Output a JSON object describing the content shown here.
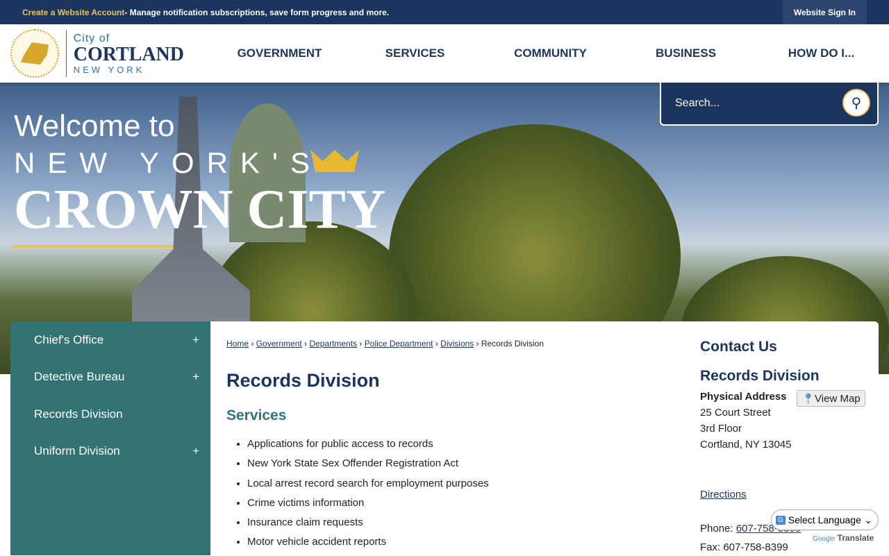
{
  "topbar": {
    "account_link": "Create a Website Account",
    "account_text": " - Manage notification subscriptions, save form progress and more.",
    "sign_in": "Website Sign In"
  },
  "logo": {
    "line1": "City of",
    "line2": "CORTLAND",
    "line3": "NEW YORK"
  },
  "nav": [
    "GOVERNMENT",
    "SERVICES",
    "COMMUNITY",
    "BUSINESS",
    "HOW DO I..."
  ],
  "hero": {
    "line1": "Welcome to",
    "line2": "NEW YORK'S",
    "line3": "CROWN CITY"
  },
  "search": {
    "placeholder": "Search..."
  },
  "sidebar": [
    {
      "label": "Chief's Office",
      "expand": "+"
    },
    {
      "label": "Detective Bureau",
      "expand": "+"
    },
    {
      "label": "Records Division",
      "expand": ""
    },
    {
      "label": "Uniform Division",
      "expand": "+"
    }
  ],
  "breadcrumb": [
    "Home",
    "Government",
    "Departments",
    "Police Department",
    "Divisions"
  ],
  "breadcrumb_current": "Records Division",
  "page_title": "Records Division",
  "section_title": "Services",
  "services": [
    "Applications for public access to records",
    "New York State Sex Offender Registration Act",
    "Local arrest record search for employment purposes",
    "Crime victims information",
    "Insurance claim requests",
    "Motor vehicle accident reports"
  ],
  "contact": {
    "heading": "Contact Us",
    "name": "Records Division",
    "address_label": "Physical Address",
    "view_map": "View Map",
    "address": [
      "25 Court Street",
      "3rd Floor",
      "Cortland, NY 13045"
    ],
    "directions": "Directions",
    "phone_label": "Phone: ",
    "phone": "607-758-8305",
    "fax": "Fax: 607-758-8399"
  },
  "translate": {
    "select": "Select Language",
    "brand": "Translate",
    "google": "Google"
  }
}
